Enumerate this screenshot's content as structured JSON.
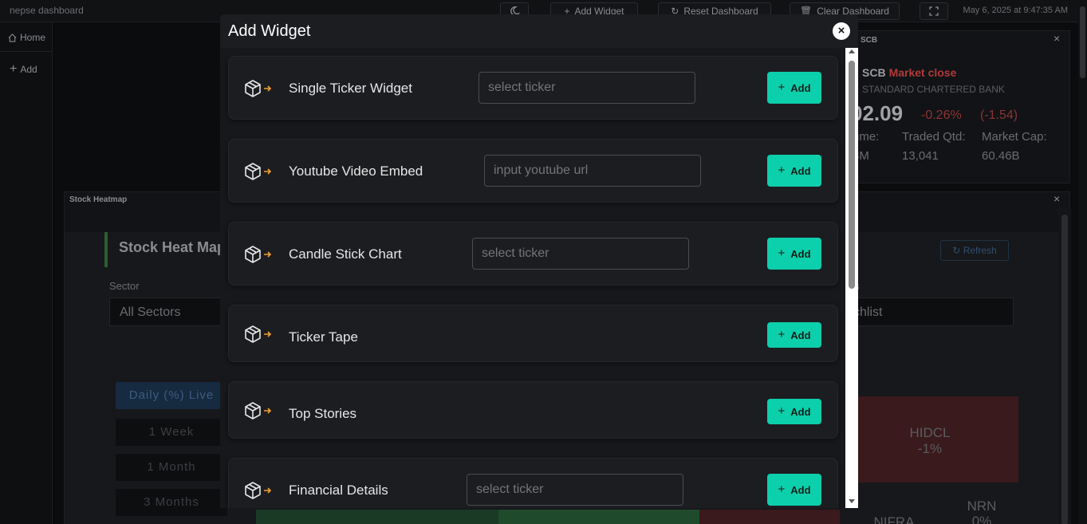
{
  "topbar": {
    "app_title": "nepse dashboard",
    "add_widget_label": "Add Widget",
    "reset_label": "Reset Dashboard",
    "clear_label": "Clear Dashboard",
    "datetime": "May 6, 2025 at 9:47:35 AM"
  },
  "sidebar": {
    "home_label": "Home",
    "add_label": "Add"
  },
  "ticker_panel": {
    "header": "SCB",
    "symbol": "SCB",
    "status": "Market close",
    "company": "STANDARD CHARTERED BANK",
    "price": "02.09",
    "change_pct": "-0.26%",
    "change_abs": "(-1.54)",
    "volume_label": "ume:",
    "volume_value": "3M",
    "traded_label": "Traded Qtd:",
    "traded_value": "13,041",
    "mcap_label": "Market Cap:",
    "mcap_value": "60.46B"
  },
  "heatmap_panel": {
    "header": "Stock Heatmap",
    "title": "Stock Heat Map",
    "refresh_label": "Refresh",
    "sector_label": "Sector",
    "sector_value": "All Sectors",
    "watch_label": "s",
    "watch_value": "chlist",
    "periods": [
      "Daily (%) Live",
      "1 Week",
      "1 Month",
      "3 Months"
    ],
    "tiles": [
      {
        "symbol": "HIDCL",
        "change": "-1%"
      },
      {
        "symbol": "NIFRA",
        "change": ""
      },
      {
        "symbol": "NRN",
        "change": "0%"
      }
    ]
  },
  "modal": {
    "title": "Add Widget",
    "close_symbol": "×",
    "add_label": "Add",
    "widgets": [
      {
        "name": "Single Ticker Widget",
        "placeholder": "select ticker",
        "has_input": true
      },
      {
        "name": "Youtube Video Embed",
        "placeholder": "input youtube url",
        "has_input": true
      },
      {
        "name": "Candle Stick Chart",
        "placeholder": "select ticker",
        "has_input": true
      },
      {
        "name": "Ticker Tape",
        "placeholder": "",
        "has_input": false
      },
      {
        "name": "Top Stories",
        "placeholder": "",
        "has_input": false
      },
      {
        "name": "Financial Details",
        "placeholder": "select ticker",
        "has_input": true
      }
    ]
  },
  "colors": {
    "accent": "#0ccfab",
    "modal_bg": "#1c1d21",
    "arrow": "#f0a030"
  }
}
